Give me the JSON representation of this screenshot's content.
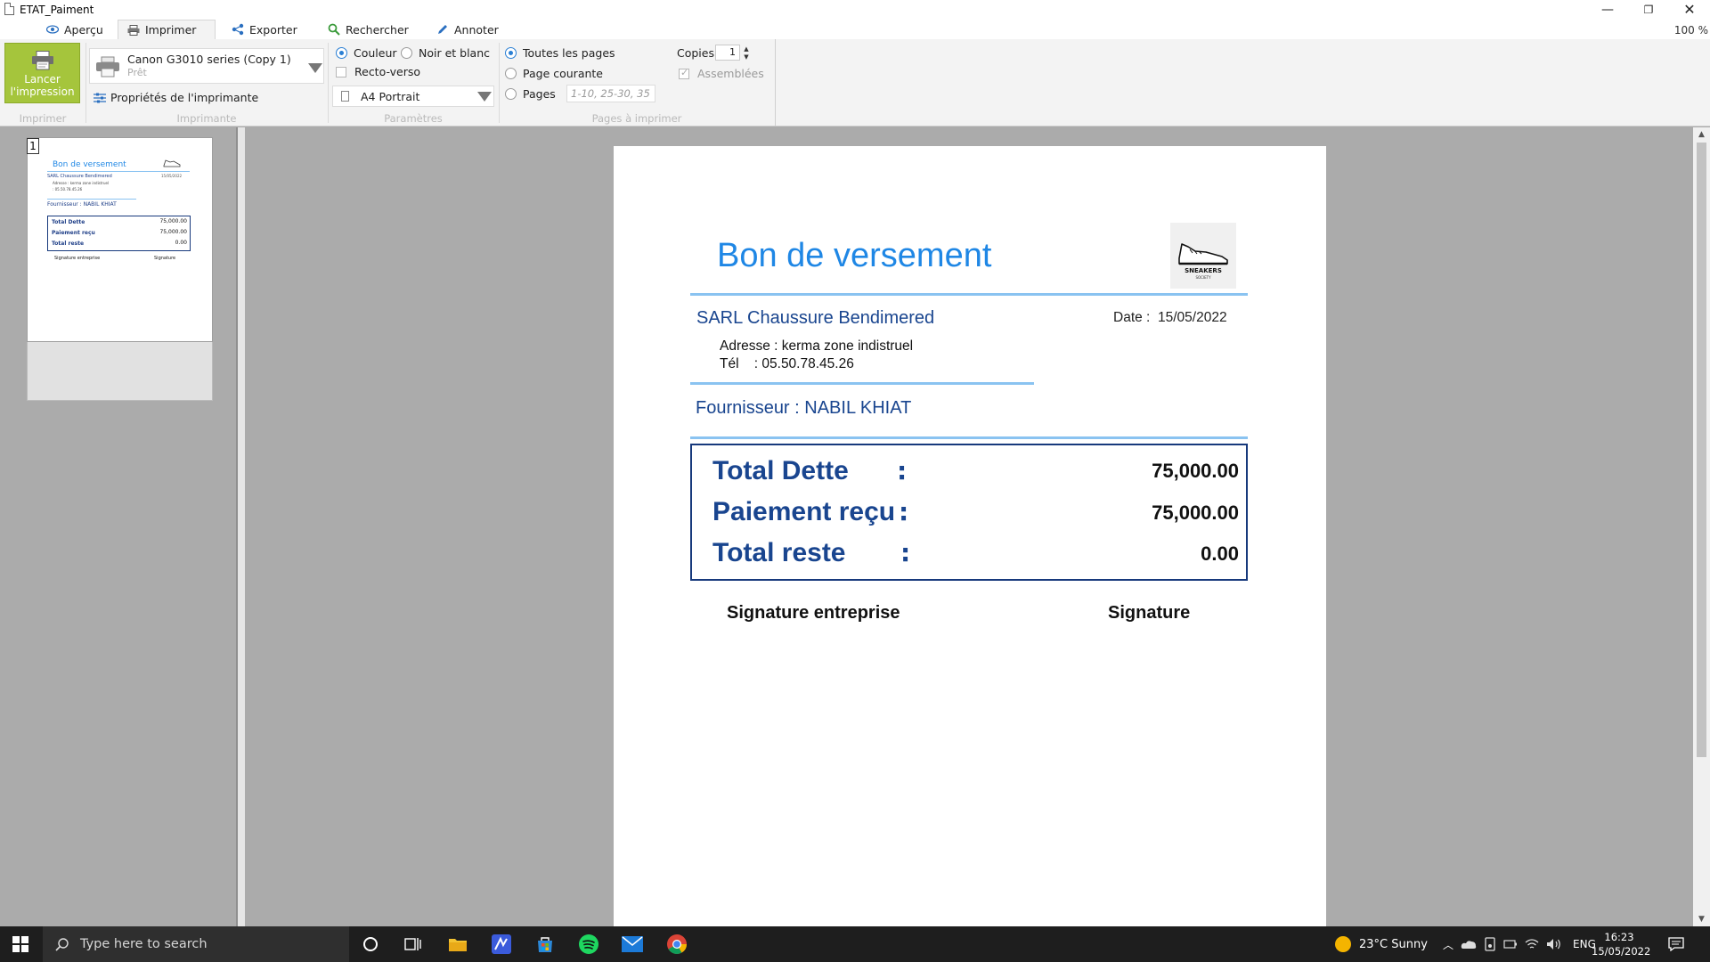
{
  "window": {
    "title": "ETAT_Paiment",
    "minimize_glyph": "—",
    "maximize_glyph": "❐",
    "close_glyph": "✕"
  },
  "tabs": [
    {
      "label": "Aperçu",
      "icon": "eye-icon"
    },
    {
      "label": "Imprimer",
      "icon": "printer-icon",
      "active": true
    },
    {
      "label": "Exporter",
      "icon": "share-icon"
    },
    {
      "label": "Rechercher",
      "icon": "search-icon"
    },
    {
      "label": "Annoter",
      "icon": "pencil-icon"
    }
  ],
  "zoom": "100 %",
  "ribbon": {
    "print_button": "Lancer\nl'impression",
    "printer_name": "Canon G3010 series (Copy 1)",
    "printer_status": "Prêt",
    "printer_properties": "Propriétés de l'imprimante",
    "color_option": "Couleur",
    "bw_option": "Noir et blanc",
    "duplex_option": "Recto-verso",
    "paper": "A4 Portrait",
    "all_pages": "Toutes les pages",
    "current_page": "Page courante",
    "pages": "Pages",
    "pages_placeholder": "1-10, 25-30, 35",
    "copies_label": "Copies",
    "copies_value": "1",
    "collate": "Assemblées",
    "groups": {
      "print": "Imprimer",
      "printer": "Imprimante",
      "parameters": "Paramètres",
      "pages": "Pages à imprimer"
    }
  },
  "thumbnail": {
    "page_number": "1"
  },
  "document": {
    "title": "Bon de versement",
    "logo_text": "SNEAKERS",
    "logo_subtext": "SOCIETY",
    "company": "SARL Chaussure Bendimered",
    "date_label": "Date :",
    "date_value": "15/05/2022",
    "address_line": "Adresse : kerma zone indistruel",
    "phone_label": "Tél",
    "phone_value": ": 05.50.78.45.26",
    "supplier": "Fournisseur : NABIL KHIAT",
    "totals": [
      {
        "label": "Total Dette",
        "value": "75,000.00"
      },
      {
        "label": "Paiement reçu",
        "value": "75,000.00"
      },
      {
        "label": "Total reste",
        "value": "0.00"
      }
    ],
    "colon": ":",
    "signature_company": "Signature entreprise",
    "signature": "Signature"
  },
  "taskbar": {
    "search_placeholder": "Type here to search",
    "weather": "23°C  Sunny",
    "language": "ENG",
    "time": "16:23",
    "date": "15/05/2022"
  },
  "colors": {
    "accent": "#1f87e5",
    "heading_blue": "#19458f",
    "print_button": "#a5c53c"
  }
}
